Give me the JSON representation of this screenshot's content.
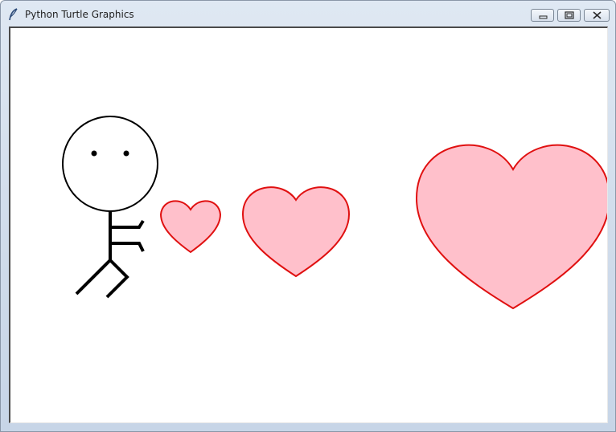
{
  "window": {
    "title": "Python Turtle Graphics",
    "app_icon": "feather-icon",
    "controls": {
      "minimize_icon": "minimize-icon",
      "maximize_icon": "maximize-icon",
      "close_icon": "close-icon"
    }
  },
  "canvas": {
    "background": "#ffffff",
    "figure": {
      "name": "stick-figure",
      "line_color": "#000000"
    },
    "hearts": [
      {
        "name": "heart-small",
        "fill": "#ffc0cb",
        "outline": "#ff0000"
      },
      {
        "name": "heart-medium",
        "fill": "#ffc0cb",
        "outline": "#ff0000"
      },
      {
        "name": "heart-large",
        "fill": "#ffc0cb",
        "outline": "#ff0000"
      }
    ]
  }
}
